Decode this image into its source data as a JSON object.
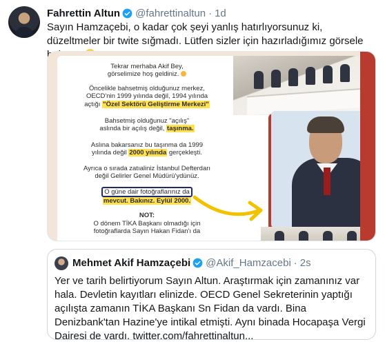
{
  "tweet": {
    "author_name": "Fahrettin Altun",
    "author_handle": "@fahrettinaltun",
    "separator": "·",
    "time": "1d",
    "text": "Sayın Hamzaçebi, o kadar çok şeyi yanlış hatırlıyorsunuz ki, düzeltmeler bir twite sığmadı. Lütfen sizler için hazırladığımız görsele bakınız"
  },
  "infographic": {
    "line1": "Tekrar merhaba Akif Bey,",
    "line2": "görselimize hoş geldiniz.",
    "line3": "Öncelikle bahsetmiş olduğunuz merkez,",
    "line4": "OECD'nin 1999 yılında değil, 1994 yılında",
    "line5_pre": "açtığı",
    "line5_hl": "\"Özel Sektörü Geliştirme Merkezi\"",
    "line6": "Bahsetmiş olduğunuz \"açılış\"",
    "line7_pre": "aslında bir açılış değil,",
    "line7_hl": "taşınma.",
    "line8": "Aslına bakarsanız bu taşınma da 1999",
    "line9_pre": "yılında değil",
    "line9_hl": "2000 yılında",
    "line9_post": "gerçekleşti.",
    "line10": "Ayrıca o sırada zatıaliniz İstanbul Defterdarı",
    "line11": "değil Gelirler Genel Müdürü'ydünüz.",
    "line12": "O güne dair fotoğraflarınız da",
    "line13": "mevcut. Bakınız. Eylül 2000.",
    "note_label": "NOT:",
    "line14": "O dönem TİKA Başkanı olmadığı için",
    "line15": "fotoğraflarda Sayın Hakan Fidan'ı da"
  },
  "quoted": {
    "author_name": "Mehmet Akif Hamzaçebi",
    "author_handle": "@Akif_Hamzacebi",
    "separator": "·",
    "time": "2s",
    "text": "Yer ve tarih belirtiyorum Sayın Altun. Araştırmak için zamanınız var hala. Devletin kayıtları elinizde. OECD Genel Sekreterinin yaptığı açılışta zamanın TİKA Başkanı Sn Fidan da vardı. Bina Denizbank'tan Hazine'ye intikal etmişti. Aynı binada Hocapaşa Vergi Dairesi de vardı. twitter.com/fahrettinaltun..."
  },
  "colors": {
    "verified": "#1da1f2",
    "highlight": "#ffe14d",
    "muted": "#657786",
    "border": "#ccd6dd"
  }
}
